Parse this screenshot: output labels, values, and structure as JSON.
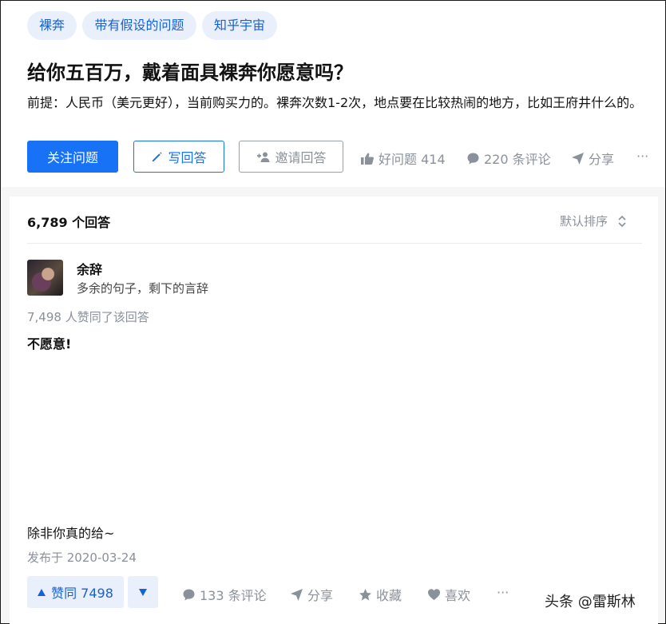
{
  "question": {
    "topics": [
      "裸奔",
      "带有假设的问题",
      "知乎宇宙"
    ],
    "title": "给你五百万，戴着面具裸奔你愿意吗？",
    "detail": "前提：人民币（美元更好），当前购买力的。裸奔次数1-2次，地点要在比较热闹的地方，比如王府井什么的。",
    "follow_label": "关注问题",
    "write_label": "写回答",
    "invite_label": "邀请回答",
    "good_question_label": "好问题 414",
    "comments_label": "220 条评论",
    "share_label": "分享",
    "more_label": "···"
  },
  "answers_header": {
    "count_label": "6,789 个回答",
    "sort_label": "默认排序"
  },
  "answer": {
    "author_name": "余辞",
    "author_bio": "多余的句子，剩下的言辞",
    "votes_text": "7,498 人赞同了该回答",
    "content_first": "不愿意!",
    "content_last": "除非你真的给~",
    "published": "发布于 2020-03-24",
    "upvote_label": "赞同 7498",
    "comments_label": "133 条评论",
    "share_label": "分享",
    "collect_label": "收藏",
    "like_label": "喜欢",
    "more_label": "···"
  },
  "watermark": "头条 @雷斯林",
  "colors": {
    "brand_blue": "#1772f6",
    "tag_bg": "#e9f0fc",
    "muted": "#8a919b"
  },
  "icons": [
    "pencil-icon",
    "add-user-icon",
    "thumbs-up-icon",
    "comment-icon",
    "paper-plane-icon",
    "triangle-up-icon",
    "triangle-down-icon",
    "star-icon",
    "heart-icon",
    "sort-icon"
  ]
}
